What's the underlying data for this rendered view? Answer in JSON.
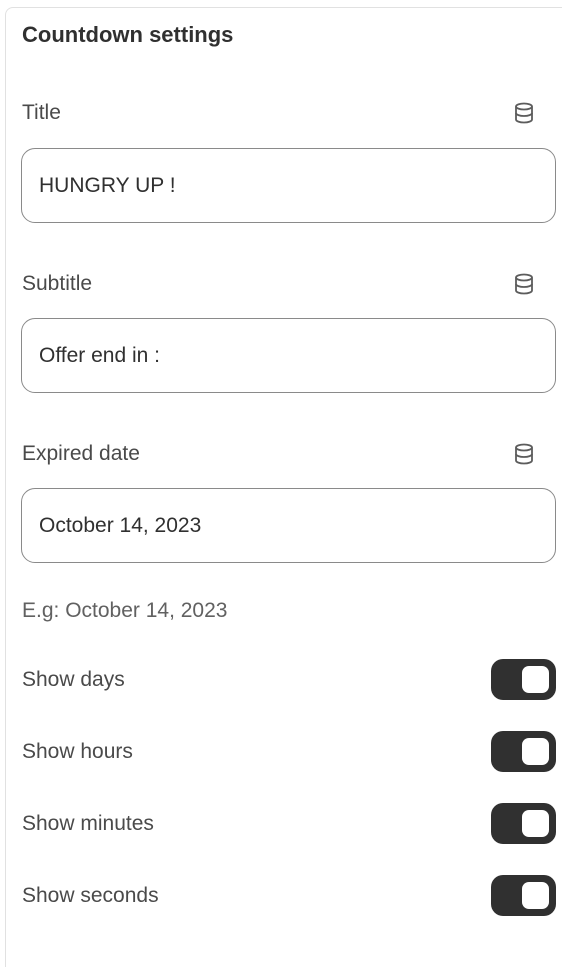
{
  "panel": {
    "title": "Countdown settings"
  },
  "fields": [
    {
      "label": "Title",
      "value": "HUNGRY UP !",
      "icon": "database-icon"
    },
    {
      "label": "Subtitle",
      "value": "Offer end in :",
      "icon": "database-icon"
    },
    {
      "label": "Expired date",
      "value": "October 14, 2023",
      "icon": "database-icon"
    }
  ],
  "hint": "E.g: October 14, 2023",
  "toggles": [
    {
      "label": "Show days",
      "on": true
    },
    {
      "label": "Show hours",
      "on": true
    },
    {
      "label": "Show minutes",
      "on": true
    },
    {
      "label": "Show seconds",
      "on": true
    }
  ],
  "colors": {
    "toggle_on": "#303030",
    "input_border": "#8a8a8a",
    "text": "#303030"
  }
}
